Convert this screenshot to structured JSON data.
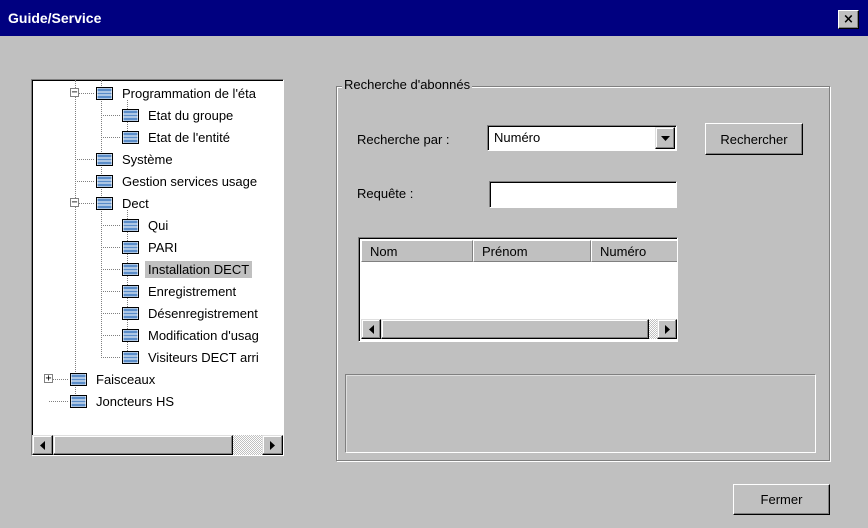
{
  "window": {
    "title": "Guide/Service",
    "close_glyph": "×"
  },
  "tree": {
    "items": [
      {
        "label": "Programmation de l'éta",
        "expander": "−"
      },
      {
        "label": "Etat du groupe"
      },
      {
        "label": "Etat de l'entité"
      },
      {
        "label": "Système"
      },
      {
        "label": "Gestion services usage"
      },
      {
        "label": "Dect",
        "expander": "−"
      },
      {
        "label": "Qui"
      },
      {
        "label": "PARI"
      },
      {
        "label": "Installation DECT",
        "selected": true
      },
      {
        "label": "Enregistrement"
      },
      {
        "label": "Désenregistrement"
      },
      {
        "label": "Modification d'usag"
      },
      {
        "label": "Visiteurs DECT arri"
      },
      {
        "label": "Faisceaux",
        "expander": "+"
      },
      {
        "label": "Joncteurs HS"
      }
    ]
  },
  "search": {
    "group_title": "Recherche d'abonnés",
    "by_label": "Recherche par :",
    "by_value": "Numéro",
    "query_label": "Requête :",
    "query_value": "",
    "search_button": "Rechercher"
  },
  "results": {
    "columns": [
      "Nom",
      "Prénom",
      "Numéro"
    ]
  },
  "footer": {
    "close_button": "Fermer"
  },
  "colors": {
    "titlebar": "#000080",
    "face": "#c0c0c0",
    "icon": "#5a8cc8"
  }
}
